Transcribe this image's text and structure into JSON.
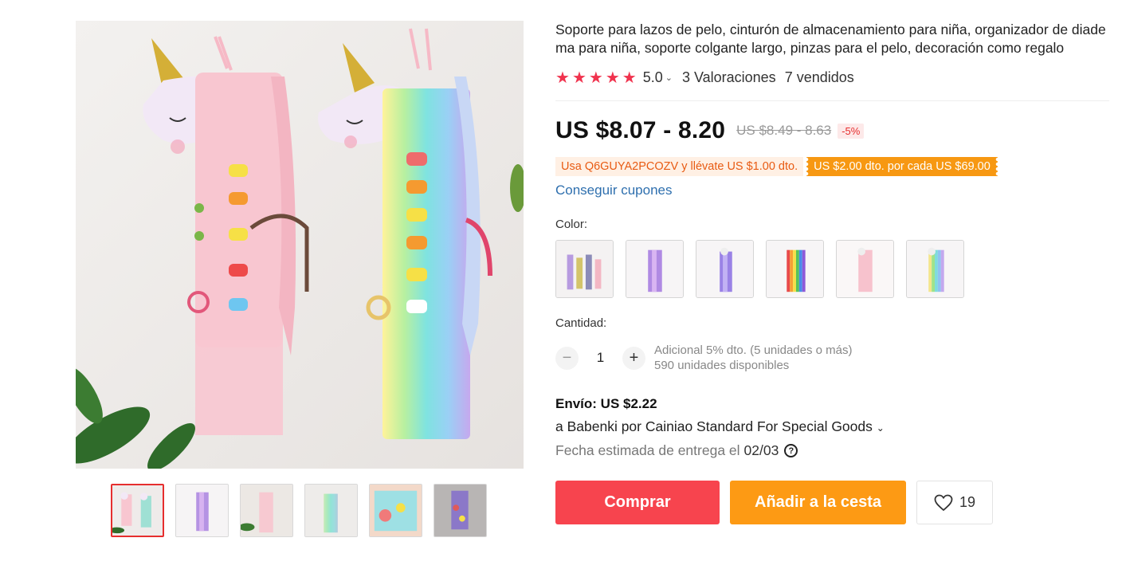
{
  "product": {
    "title": "Soporte para lazos de pelo, cinturón de almacenamiento para niña, organizador de diadema para niña, soporte colgante largo, pinzas para el pelo, decoración como regalo",
    "rating_value": "5.0",
    "reviews": "3 Valoraciones",
    "sold": "7 vendidos",
    "star_count": 5
  },
  "gallery": {
    "main_image": "unicorn-hair-bow-holders-photo",
    "thumbnail_count": 6,
    "active_thumbnail": 0
  },
  "price": {
    "current": "US $8.07 - 8.20",
    "original": "US $8.49 - 8.63",
    "discount": "-5%"
  },
  "promotions": {
    "coupon_text": "Usa Q6GUYA2PCOZV y llévate US $1.00 dto.",
    "store_discount": "US $2.00 dto. por cada US $69.00",
    "get_coupons": "Conseguir cupones"
  },
  "variants": {
    "label": "Color:",
    "swatch_count": 6
  },
  "quantity": {
    "label": "Cantidad:",
    "value": "1",
    "minus": "−",
    "plus": "+",
    "extra_discount": "Adicional 5% dto. (5 unidades o más)",
    "available": "590 unidades disponibles"
  },
  "shipping": {
    "price": "Envío: US $2.22",
    "carrier": "a Babenki por Cainiao Standard For Special Goods",
    "date_label": "Fecha estimada de entrega el",
    "date_value": "02/03"
  },
  "actions": {
    "buy": "Comprar",
    "cart": "Añadir a la cesta",
    "wishlist_count": "19"
  },
  "colors": {
    "accent_red": "#f7444e",
    "accent_orange": "#fd9a14",
    "star_color": "#f0334e",
    "link_blue": "#2e6fae"
  }
}
